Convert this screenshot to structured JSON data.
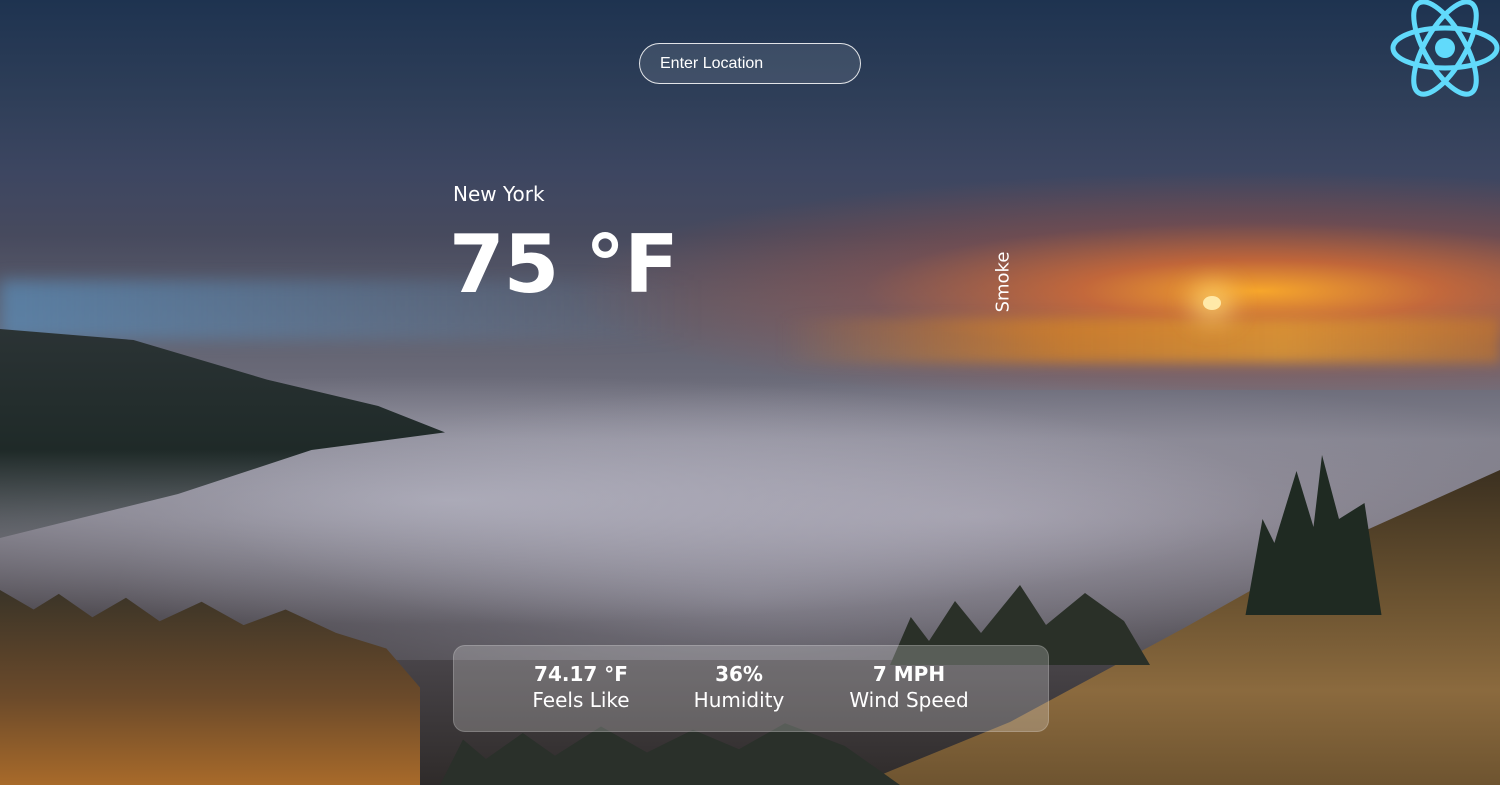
{
  "search": {
    "placeholder": "Enter Location"
  },
  "brand": {
    "icon": "react-logo-icon",
    "color": "#61dafb"
  },
  "weather": {
    "city": "New York",
    "temperature": "75 °F",
    "description": "Smoke"
  },
  "stats": [
    {
      "value": "74.17 °F",
      "label": "Feels Like"
    },
    {
      "value": "36%",
      "label": "Humidity"
    },
    {
      "value": "7 MPH",
      "label": "Wind Speed"
    }
  ]
}
